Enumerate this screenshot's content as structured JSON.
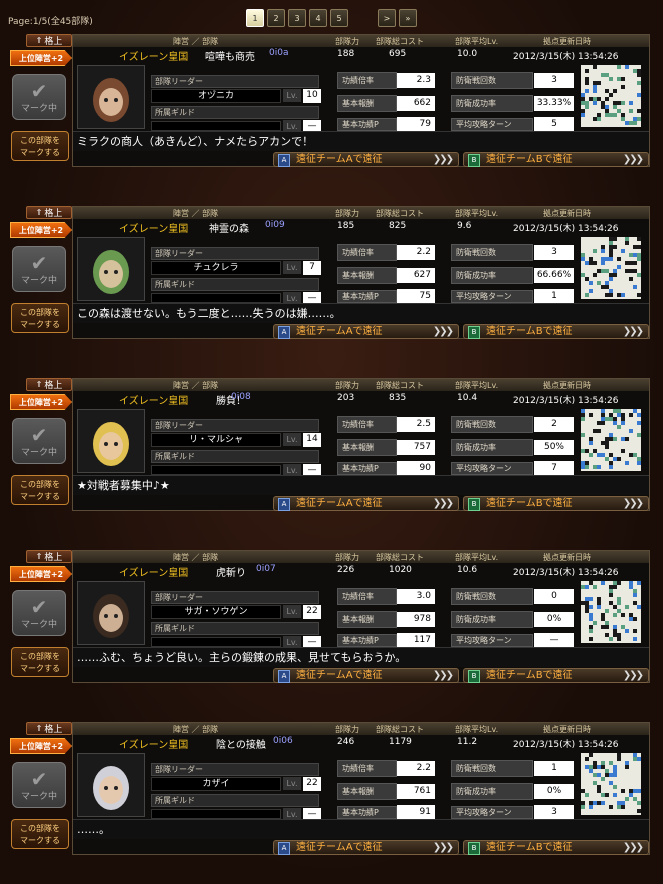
{
  "page_info": "Page:1/5(全45部隊)",
  "pager": {
    "pages": [
      "1",
      "2",
      "3",
      "4",
      "5"
    ],
    "active": "1",
    "next": ">",
    "last": "»"
  },
  "headers": {
    "affiliation": "陣営 ／ 部隊",
    "power": "部隊力",
    "cost": "部隊総コスト",
    "avg_lv": "部隊平均Lv.",
    "updated": "拠点更新日時"
  },
  "labels": {
    "kakuage": "格上",
    "joui": "上位陣営+2",
    "marked": "マーク中",
    "mark_this": "この部隊を\nマークする",
    "leader": "部隊リーダー",
    "guild": "所属ギルド",
    "lv": "Lv.",
    "combo": "功績倍率",
    "reward": "基本報酬",
    "merit": "基本功績P",
    "def_count": "防衛戦回数",
    "def_rate": "防衛成功率",
    "avg_turn": "平均攻略ターン",
    "ensei_a": "遠征チームAで遠征",
    "ensei_b": "遠征チームBで遠征"
  },
  "units": [
    {
      "nation": "イズレーン皇国",
      "name": "喧嘩も商売",
      "id": "0i0a",
      "power": "188",
      "cost": "695",
      "avg_lv": "10.0",
      "updated": "2012/3/15(木) 13:54:26",
      "leader": "オヅニカ",
      "leader_lv": "10",
      "guild": "",
      "guild_lv": "—",
      "combo": "2.3",
      "reward": "662",
      "merit": "79",
      "def_count": "3",
      "def_rate": "33.33%",
      "avg_turn": "5",
      "comment": "ミラクの商人（あきんど）、ナメたらアカンで！",
      "avatar_color": "#7a4a30"
    },
    {
      "nation": "イズレーン皇国",
      "name": "神霊の森",
      "id": "0i09",
      "power": "185",
      "cost": "825",
      "avg_lv": "9.6",
      "updated": "2012/3/15(木) 13:54:26",
      "leader": "チュクレラ",
      "leader_lv": "7",
      "guild": "",
      "guild_lv": "—",
      "combo": "2.2",
      "reward": "627",
      "merit": "75",
      "def_count": "3",
      "def_rate": "66.66%",
      "avg_turn": "1",
      "comment": "この森は渡せない。もう二度と……失うのは嫌……。",
      "avatar_color": "#6a9a50"
    },
    {
      "nation": "イズレーン皇国",
      "name": "勝負！",
      "id": "0i08",
      "power": "203",
      "cost": "835",
      "avg_lv": "10.4",
      "updated": "2012/3/15(木) 13:54:26",
      "leader": "リ・マルシャ",
      "leader_lv": "14",
      "guild": "",
      "guild_lv": "—",
      "combo": "2.5",
      "reward": "757",
      "merit": "90",
      "def_count": "2",
      "def_rate": "50%",
      "avg_turn": "7",
      "comment": "★対戦者募集中♪★",
      "avatar_color": "#e0c050"
    },
    {
      "nation": "イズレーン皇国",
      "name": "虎斬り",
      "id": "0i07",
      "power": "226",
      "cost": "1020",
      "avg_lv": "10.6",
      "updated": "2012/3/15(木) 13:54:26",
      "leader": "サガ・ソウゲン",
      "leader_lv": "22",
      "guild": "",
      "guild_lv": "—",
      "combo": "3.0",
      "reward": "978",
      "merit": "117",
      "def_count": "0",
      "def_rate": "0%",
      "avg_turn": "—",
      "comment": "……ふむ、ちょうど良い。主らの鍛錬の成果、見せてもらおうか。",
      "avatar_color": "#3a2a20"
    },
    {
      "nation": "イズレーン皇国",
      "name": "陰との接触",
      "id": "0i06",
      "power": "246",
      "cost": "1179",
      "avg_lv": "11.2",
      "updated": "2012/3/15(木) 13:54:26",
      "leader": "カザイ",
      "leader_lv": "22",
      "guild": "",
      "guild_lv": "—",
      "combo": "2.2",
      "reward": "761",
      "merit": "91",
      "def_count": "1",
      "def_rate": "0%",
      "avg_turn": "3",
      "comment": "……。",
      "avatar_color": "#d0d0d8"
    }
  ]
}
